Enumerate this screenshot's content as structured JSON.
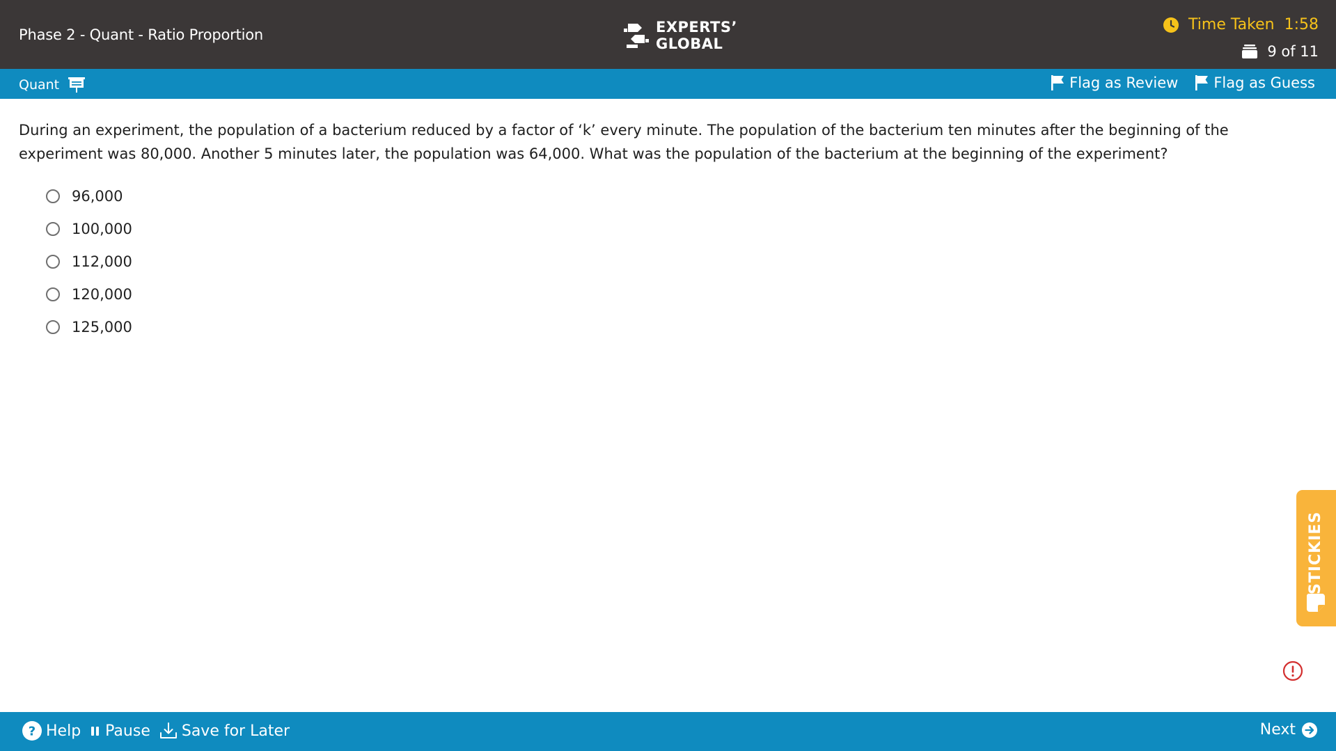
{
  "header": {
    "title": "Phase 2 - Quant - Ratio Proportion",
    "logo_line1": "EXPERTS’",
    "logo_line2": "GLOBAL",
    "timer_label": "Time Taken",
    "timer_value": "1:58",
    "progress": "9 of 11"
  },
  "subbar": {
    "section": "Quant",
    "flag_review": "Flag as Review",
    "flag_guess": "Flag as Guess"
  },
  "question": {
    "text": "During an experiment, the population of a bacterium reduced by a factor of ‘k’ every minute. The population of the bacterium ten minutes after the beginning of the experiment was 80,000. Another 5 minutes later,  the population was 64,000. What was the population of the bacterium at the beginning of the experiment?",
    "options": [
      "96,000",
      "100,000",
      "112,000",
      "120,000",
      "125,000"
    ]
  },
  "stickies": {
    "label": "STICKIES"
  },
  "footer": {
    "help": "Help",
    "pause": "Pause",
    "save": "Save for Later",
    "next": "Next"
  },
  "icons": {
    "clock": "clock-icon",
    "stack": "question-stack-icon",
    "section": "presentation-board-icon",
    "flag": "flag-icon",
    "help": "help-circle-icon",
    "pause": "pause-icon",
    "save": "download-icon",
    "next": "arrow-right-circle-icon",
    "alert": "alert-circle-icon",
    "sticky": "sticky-note-icon"
  },
  "colors": {
    "topbar": "#3b3737",
    "accent": "#0f8bbf",
    "timer": "#f6c21a",
    "stickies": "#f9b43b",
    "alert": "#d32f2f"
  }
}
